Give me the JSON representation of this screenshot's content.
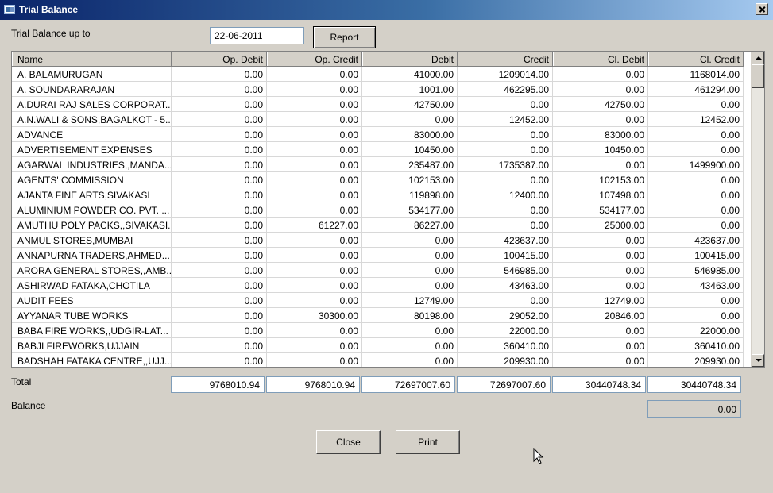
{
  "window": {
    "title": "Trial Balance"
  },
  "filter": {
    "label": "Trial Balance up to",
    "date": "22-06-2011",
    "report_label": "Report"
  },
  "table": {
    "columns": [
      "Name",
      "Op. Debit",
      "Op. Credit",
      "Debit",
      "Credit",
      "Cl. Debit",
      "Cl. Credit"
    ],
    "rows": [
      [
        "A. BALAMURUGAN",
        "0.00",
        "0.00",
        "41000.00",
        "1209014.00",
        "0.00",
        "1168014.00"
      ],
      [
        "A. SOUNDARARAJAN",
        "0.00",
        "0.00",
        "1001.00",
        "462295.00",
        "0.00",
        "461294.00"
      ],
      [
        "A.DURAI RAJ SALES CORPORAT...",
        "0.00",
        "0.00",
        "42750.00",
        "0.00",
        "42750.00",
        "0.00"
      ],
      [
        "A.N.WALI & SONS,BAGALKOT - 5...",
        "0.00",
        "0.00",
        "0.00",
        "12452.00",
        "0.00",
        "12452.00"
      ],
      [
        "ADVANCE",
        "0.00",
        "0.00",
        "83000.00",
        "0.00",
        "83000.00",
        "0.00"
      ],
      [
        "ADVERTISEMENT EXPENSES",
        "0.00",
        "0.00",
        "10450.00",
        "0.00",
        "10450.00",
        "0.00"
      ],
      [
        "AGARWAL INDUSTRIES,,MANDA...",
        "0.00",
        "0.00",
        "235487.00",
        "1735387.00",
        "0.00",
        "1499900.00"
      ],
      [
        "AGENTS' COMMISSION",
        "0.00",
        "0.00",
        "102153.00",
        "0.00",
        "102153.00",
        "0.00"
      ],
      [
        "AJANTA FINE ARTS,SIVAKASI",
        "0.00",
        "0.00",
        "119898.00",
        "12400.00",
        "107498.00",
        "0.00"
      ],
      [
        "ALUMINIUM POWDER CO. PVT. ...",
        "0.00",
        "0.00",
        "534177.00",
        "0.00",
        "534177.00",
        "0.00"
      ],
      [
        "AMUTHU POLY PACKS,,SIVAKASI.",
        "0.00",
        "61227.00",
        "86227.00",
        "0.00",
        "25000.00",
        "0.00"
      ],
      [
        "ANMUL STORES,MUMBAI",
        "0.00",
        "0.00",
        "0.00",
        "423637.00",
        "0.00",
        "423637.00"
      ],
      [
        "ANNAPURNA TRADERS,AHMED...",
        "0.00",
        "0.00",
        "0.00",
        "100415.00",
        "0.00",
        "100415.00"
      ],
      [
        "ARORA GENERAL STORES,,AMB...",
        "0.00",
        "0.00",
        "0.00",
        "546985.00",
        "0.00",
        "546985.00"
      ],
      [
        "ASHIRWAD FATAKA,CHOTILA",
        "0.00",
        "0.00",
        "0.00",
        "43463.00",
        "0.00",
        "43463.00"
      ],
      [
        "AUDIT FEES",
        "0.00",
        "0.00",
        "12749.00",
        "0.00",
        "12749.00",
        "0.00"
      ],
      [
        "AYYANAR TUBE WORKS",
        "0.00",
        "30300.00",
        "80198.00",
        "29052.00",
        "20846.00",
        "0.00"
      ],
      [
        "BABA FIRE WORKS,,UDGIR-LAT...",
        "0.00",
        "0.00",
        "0.00",
        "22000.00",
        "0.00",
        "22000.00"
      ],
      [
        "BABJI FIREWORKS,UJJAIN",
        "0.00",
        "0.00",
        "0.00",
        "360410.00",
        "0.00",
        "360410.00"
      ],
      [
        "BADSHAH FATAKA CENTRE,,UJJ...",
        "0.00",
        "0.00",
        "0.00",
        "209930.00",
        "0.00",
        "209930.00"
      ]
    ]
  },
  "totals": {
    "label": "Total",
    "op_debit": "9768010.94",
    "op_credit": "9768010.94",
    "debit": "72697007.60",
    "credit": "72697007.60",
    "cl_debit": "30440748.34",
    "cl_credit": "30440748.34"
  },
  "balance": {
    "label": "Balance",
    "value": "0.00"
  },
  "buttons": {
    "close_label": "Close",
    "print_label": "Print"
  }
}
